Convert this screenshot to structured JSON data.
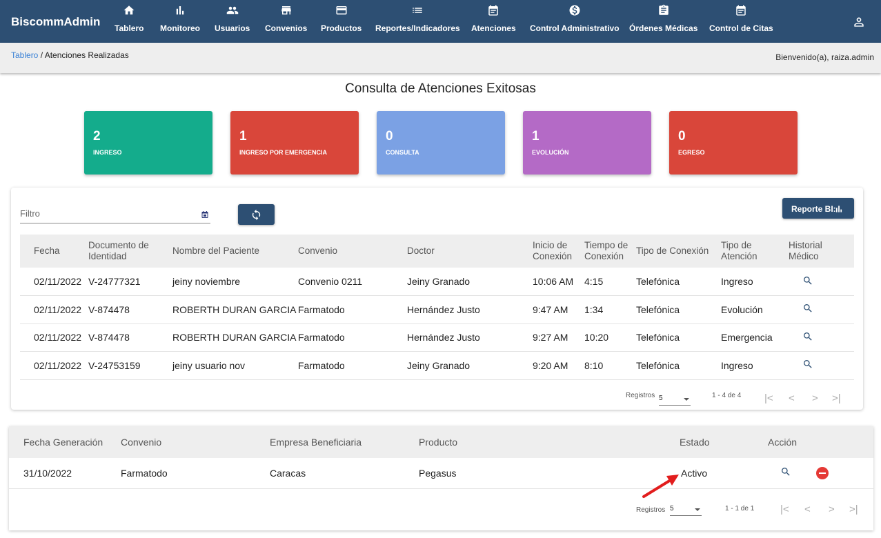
{
  "app": {
    "brand": "BiscommAdmin"
  },
  "nav": [
    {
      "label": "Tablero",
      "icon": "home-icon"
    },
    {
      "label": "Monitoreo",
      "icon": "bar-chart-icon"
    },
    {
      "label": "Usuarios",
      "icon": "people-icon"
    },
    {
      "label": "Convenios",
      "icon": "store-icon"
    },
    {
      "label": "Productos",
      "icon": "credit-card-icon"
    },
    {
      "label": "Reportes/Indicadores",
      "icon": "list-icon"
    },
    {
      "label": "Atenciones",
      "icon": "calendar-icon"
    },
    {
      "label": "Control Administrativo",
      "icon": "dollar-icon"
    },
    {
      "label": "Órdenes Médicas",
      "icon": "clipboard-icon"
    },
    {
      "label": "Control de Citas",
      "icon": "calendar-icon"
    }
  ],
  "breadcrumb": {
    "root": "Tablero",
    "separator": " / ",
    "current": "Atenciones Realizadas"
  },
  "welcome": "Bienvenido(a), raiza.admin",
  "page_title": "Consulta de Atenciones Exitosas",
  "cards": [
    {
      "value": "2",
      "label": "INGRESO",
      "color": "#14ac8c"
    },
    {
      "value": "1",
      "label": "INGRESO POR EMERGENCIA",
      "color": "#d9463a"
    },
    {
      "value": "0",
      "label": "CONSULTA",
      "color": "#7ba1e4"
    },
    {
      "value": "1",
      "label": "EVOLUCIÓN",
      "color": "#b46ac6"
    },
    {
      "value": "0",
      "label": "EGRESO",
      "color": "#d9463a"
    }
  ],
  "filter": {
    "placeholder": "Filtro"
  },
  "report_button": "Reporte BI:",
  "table1": {
    "headers": [
      "Fecha",
      "Documento de Identidad",
      "Nombre del Paciente",
      "Convenio",
      "Doctor",
      "Inicio de Conexión",
      "Tiempo de Conexión",
      "Tipo de Conexión",
      "Tipo de Atención",
      "Historial Médico"
    ],
    "rows": [
      [
        "02/11/2022",
        "V-24777321",
        "jeiny noviembre",
        "Convenio 0211",
        "Jeiny Granado",
        "10:06 AM",
        "4:15",
        "Telefónica",
        "Ingreso"
      ],
      [
        "02/11/2022",
        "V-874478",
        "ROBERTH DURAN GARCIA",
        "Farmatodo",
        "Hernández Justo",
        "9:47 AM",
        "1:34",
        "Telefónica",
        "Evolución"
      ],
      [
        "02/11/2022",
        "V-874478",
        "ROBERTH DURAN GARCIA",
        "Farmatodo",
        "Hernández Justo",
        "9:27 AM",
        "10:20",
        "Telefónica",
        "Emergencia"
      ],
      [
        "02/11/2022",
        "V-24753159",
        "jeiny usuario nov",
        "Farmatodo",
        "Jeiny Granado",
        "9:20 AM",
        "8:10",
        "Telefónica",
        "Ingreso"
      ]
    ],
    "pager": {
      "label": "Registros",
      "page_size": "5",
      "range": "1 - 4 de 4"
    }
  },
  "table2": {
    "headers": [
      "Fecha Generación",
      "Convenio",
      "Empresa Beneficiaria",
      "Producto",
      "Estado",
      "Acción"
    ],
    "rows": [
      [
        "31/10/2022",
        "Farmatodo",
        "Caracas",
        "Pegasus",
        "Activo"
      ]
    ],
    "pager": {
      "label": "Registros",
      "page_size": "5",
      "range": "1 - 1 de 1"
    }
  },
  "colors": {
    "primary": "#2d4f73",
    "annotation_arrow": "#e21d1d"
  }
}
